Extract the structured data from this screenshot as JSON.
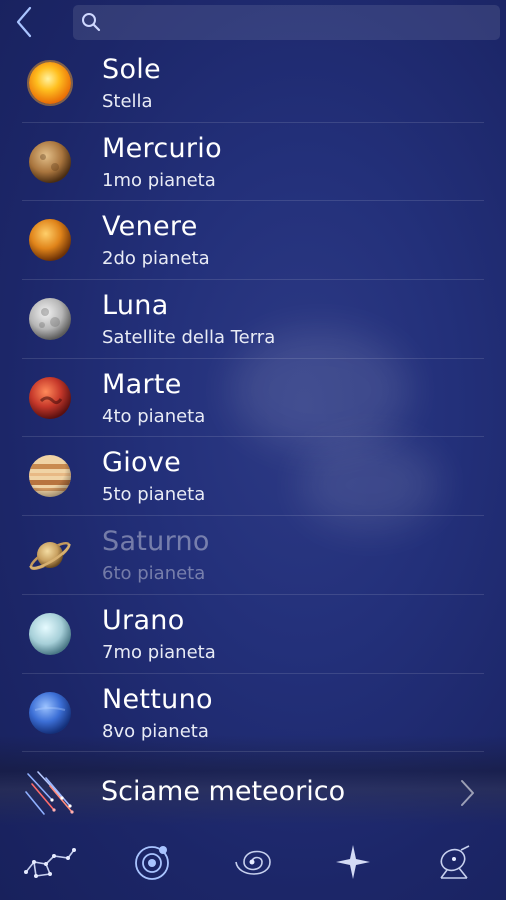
{
  "search": {
    "placeholder": ""
  },
  "items": [
    {
      "name": "Sole",
      "subtitle": "Stella",
      "icon": "sun-icon"
    },
    {
      "name": "Mercurio",
      "subtitle": "1mo pianeta",
      "icon": "mercury-icon"
    },
    {
      "name": "Venere",
      "subtitle": "2do pianeta",
      "icon": "venus-icon"
    },
    {
      "name": "Luna",
      "subtitle": "Satellite della Terra",
      "icon": "moon-icon"
    },
    {
      "name": "Marte",
      "subtitle": "4to pianeta",
      "icon": "mars-icon"
    },
    {
      "name": "Giove",
      "subtitle": "5to pianeta",
      "icon": "jupiter-icon"
    },
    {
      "name": "Saturno",
      "subtitle": "6to pianeta",
      "icon": "saturn-icon"
    },
    {
      "name": "Urano",
      "subtitle": "7mo pianeta",
      "icon": "uranus-icon"
    },
    {
      "name": "Nettuno",
      "subtitle": "8vo pianeta",
      "icon": "neptune-icon"
    }
  ],
  "meteor": {
    "label": "Sciame meteorico",
    "icon": "meteor-shower-icon"
  },
  "tabs": [
    {
      "icon": "constellation-icon"
    },
    {
      "icon": "solar-system-icon",
      "active": true
    },
    {
      "icon": "galaxy-icon"
    },
    {
      "icon": "star-icon"
    },
    {
      "icon": "satellite-icon"
    }
  ],
  "colors": {
    "background": "#1f2a6e",
    "text": "#ffffff",
    "dimmed_text": "#7b83ad",
    "accent": "#9fc1ff"
  }
}
